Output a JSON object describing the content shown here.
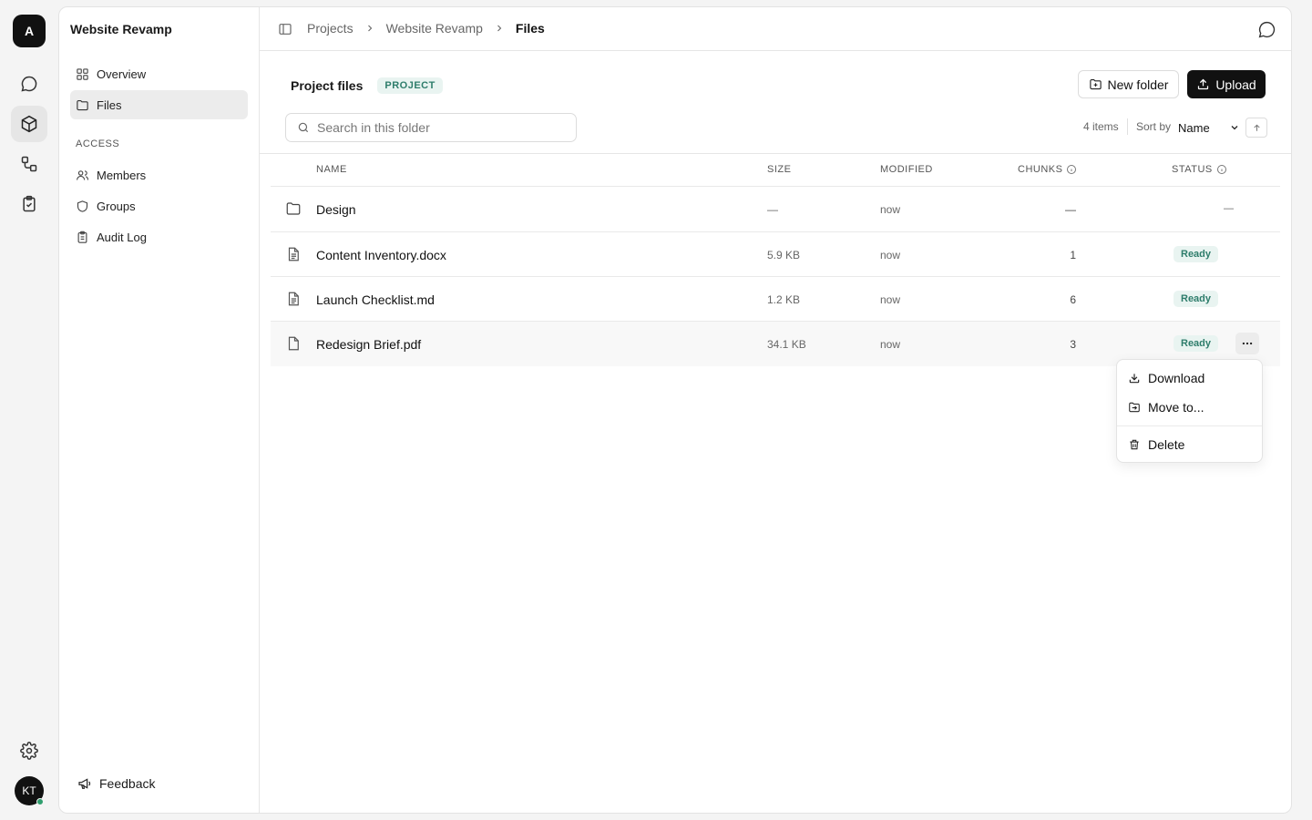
{
  "rail": {
    "logo": "A",
    "icons": [
      "chat-icon",
      "cube-icon",
      "workflow-icon",
      "clipboard-check-icon",
      "gear-icon"
    ],
    "avatar_initials": "KT",
    "presence_color": "#2f9e6e"
  },
  "sidebar": {
    "title": "Website Revamp",
    "items": [
      {
        "label": "Overview",
        "icon": "grid-icon"
      },
      {
        "label": "Files",
        "icon": "folder-icon",
        "active": true
      }
    ],
    "section_label": "ACCESS",
    "access_items": [
      {
        "label": "Members",
        "icon": "users-icon"
      },
      {
        "label": "Groups",
        "icon": "shield-icon"
      },
      {
        "label": "Audit Log",
        "icon": "clipboard-icon"
      }
    ],
    "feedback": "Feedback"
  },
  "header": {
    "breadcrumb": [
      "Projects",
      "Website Revamp",
      "Files"
    ]
  },
  "files": {
    "title": "Project files",
    "badge": "PROJECT",
    "new_folder": "New folder",
    "upload": "Upload",
    "search_placeholder": "Search in this folder",
    "count": "4 items",
    "sort_label": "Sort by",
    "sort_value": "Name",
    "columns": {
      "name": "NAME",
      "size": "SIZE",
      "modified": "MODIFIED",
      "chunks": "CHUNKS",
      "status": "STATUS"
    },
    "rows": [
      {
        "name": "Design",
        "type": "folder",
        "size": "—",
        "modified": "now",
        "chunks": "—",
        "status": "—"
      },
      {
        "name": "Content Inventory.docx",
        "type": "doc",
        "size": "5.9 KB",
        "modified": "now",
        "chunks": "1",
        "status": "Ready"
      },
      {
        "name": "Launch Checklist.md",
        "type": "doc",
        "size": "1.2 KB",
        "modified": "now",
        "chunks": "6",
        "status": "Ready"
      },
      {
        "name": "Redesign Brief.pdf",
        "type": "file",
        "size": "34.1 KB",
        "modified": "now",
        "chunks": "3",
        "status": "Ready"
      }
    ]
  },
  "context_menu": {
    "items": [
      {
        "label": "Download",
        "icon": "download-icon"
      },
      {
        "label": "Move to...",
        "icon": "move-icon"
      },
      {
        "label": "Delete",
        "icon": "trash-icon"
      }
    ]
  },
  "colors": {
    "accent": "#111111",
    "ready_bg": "#e9f4f1",
    "ready_text": "#2e7d6b"
  }
}
